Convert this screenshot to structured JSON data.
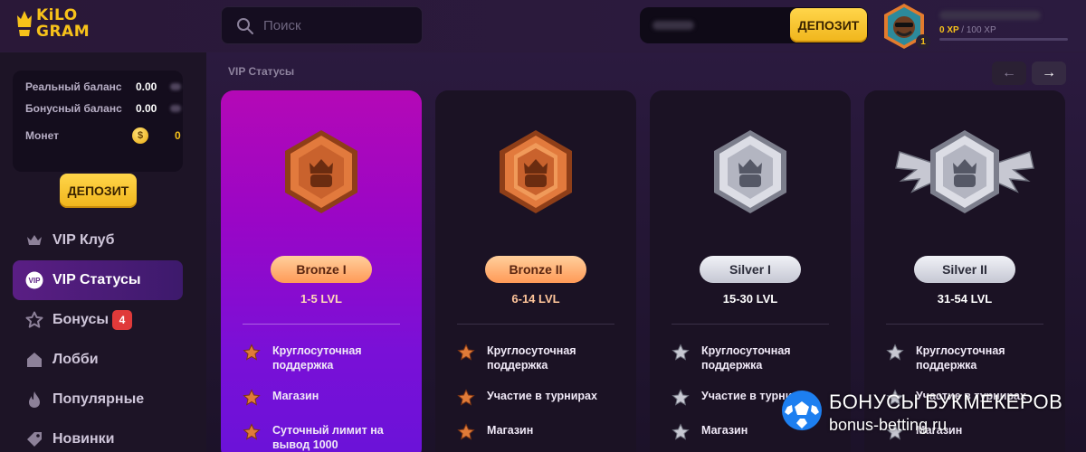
{
  "header": {
    "logo": {
      "line1": "KiLO",
      "line2": "GRAM"
    },
    "search": {
      "placeholder": "Поиск",
      "icon": "search-icon"
    },
    "deposit_label": "ДЕПОЗИТ",
    "user": {
      "level": "1",
      "xp_current": "0 XP",
      "xp_sep": "/",
      "xp_total": "100 XP",
      "xp_progress": 0
    }
  },
  "sidebar": {
    "balances": [
      {
        "label": "Реальный баланс",
        "value": "0.00"
      },
      {
        "label": "Бонусный баланс",
        "value": "0.00"
      },
      {
        "label": "Монет",
        "value": "0",
        "icon": "coin-icon",
        "coin_symbol": "$"
      }
    ],
    "deposit_label": "ДЕПОЗИТ",
    "nav": [
      {
        "label": "VIP Клуб",
        "icon": "crown-icon",
        "active": false
      },
      {
        "label": "VIP Статусы",
        "icon": "vip-icon",
        "icon_text": "VIP",
        "active": true
      },
      {
        "label": "Бонусы",
        "icon": "star-icon",
        "badge": "4",
        "active": false
      },
      {
        "label": "Лобби",
        "icon": "home-icon",
        "active": false
      },
      {
        "label": "Популярные",
        "icon": "fire-icon",
        "active": false
      },
      {
        "label": "Новинки",
        "icon": "tag-icon",
        "active": false
      }
    ]
  },
  "main": {
    "section_title": "VIP Статусы",
    "arrows": {
      "prev": "←",
      "next": "→"
    },
    "cards": [
      {
        "tier": "Bronze I",
        "levels": "1-5 LVL",
        "metal": "bronze",
        "active": true,
        "perks": [
          "Круглосуточная поддержка",
          "Магазин",
          "Суточный лимит на вывод 1000"
        ]
      },
      {
        "tier": "Bronze II",
        "levels": "6-14 LVL",
        "metal": "bronze",
        "active": false,
        "perks": [
          "Круглосуточная поддержка",
          "Участие в турнирах",
          "Магазин"
        ]
      },
      {
        "tier": "Silver I",
        "levels": "15-30 LVL",
        "metal": "silver",
        "active": false,
        "perks": [
          "Круглосуточная поддержка",
          "Участие в турнирах",
          "Магазин"
        ]
      },
      {
        "tier": "Silver II",
        "levels": "31-54 LVL",
        "metal": "silver",
        "active": false,
        "perks": [
          "Круглосуточная поддержка",
          "Участие в турнирах",
          "Магазин"
        ]
      }
    ]
  },
  "watermark": {
    "line1": "БОНУСЫ БУКМЕКЕРОВ",
    "line2": "bonus-betting.ru"
  },
  "colors": {
    "accent_gold": "#f7c21a",
    "active_card_gradient_top": "#b408b6",
    "active_card_gradient_bottom": "#6a12d8",
    "bronze": "#d8743c",
    "silver": "#c7c8d2",
    "badge_red": "#e03a3a"
  }
}
